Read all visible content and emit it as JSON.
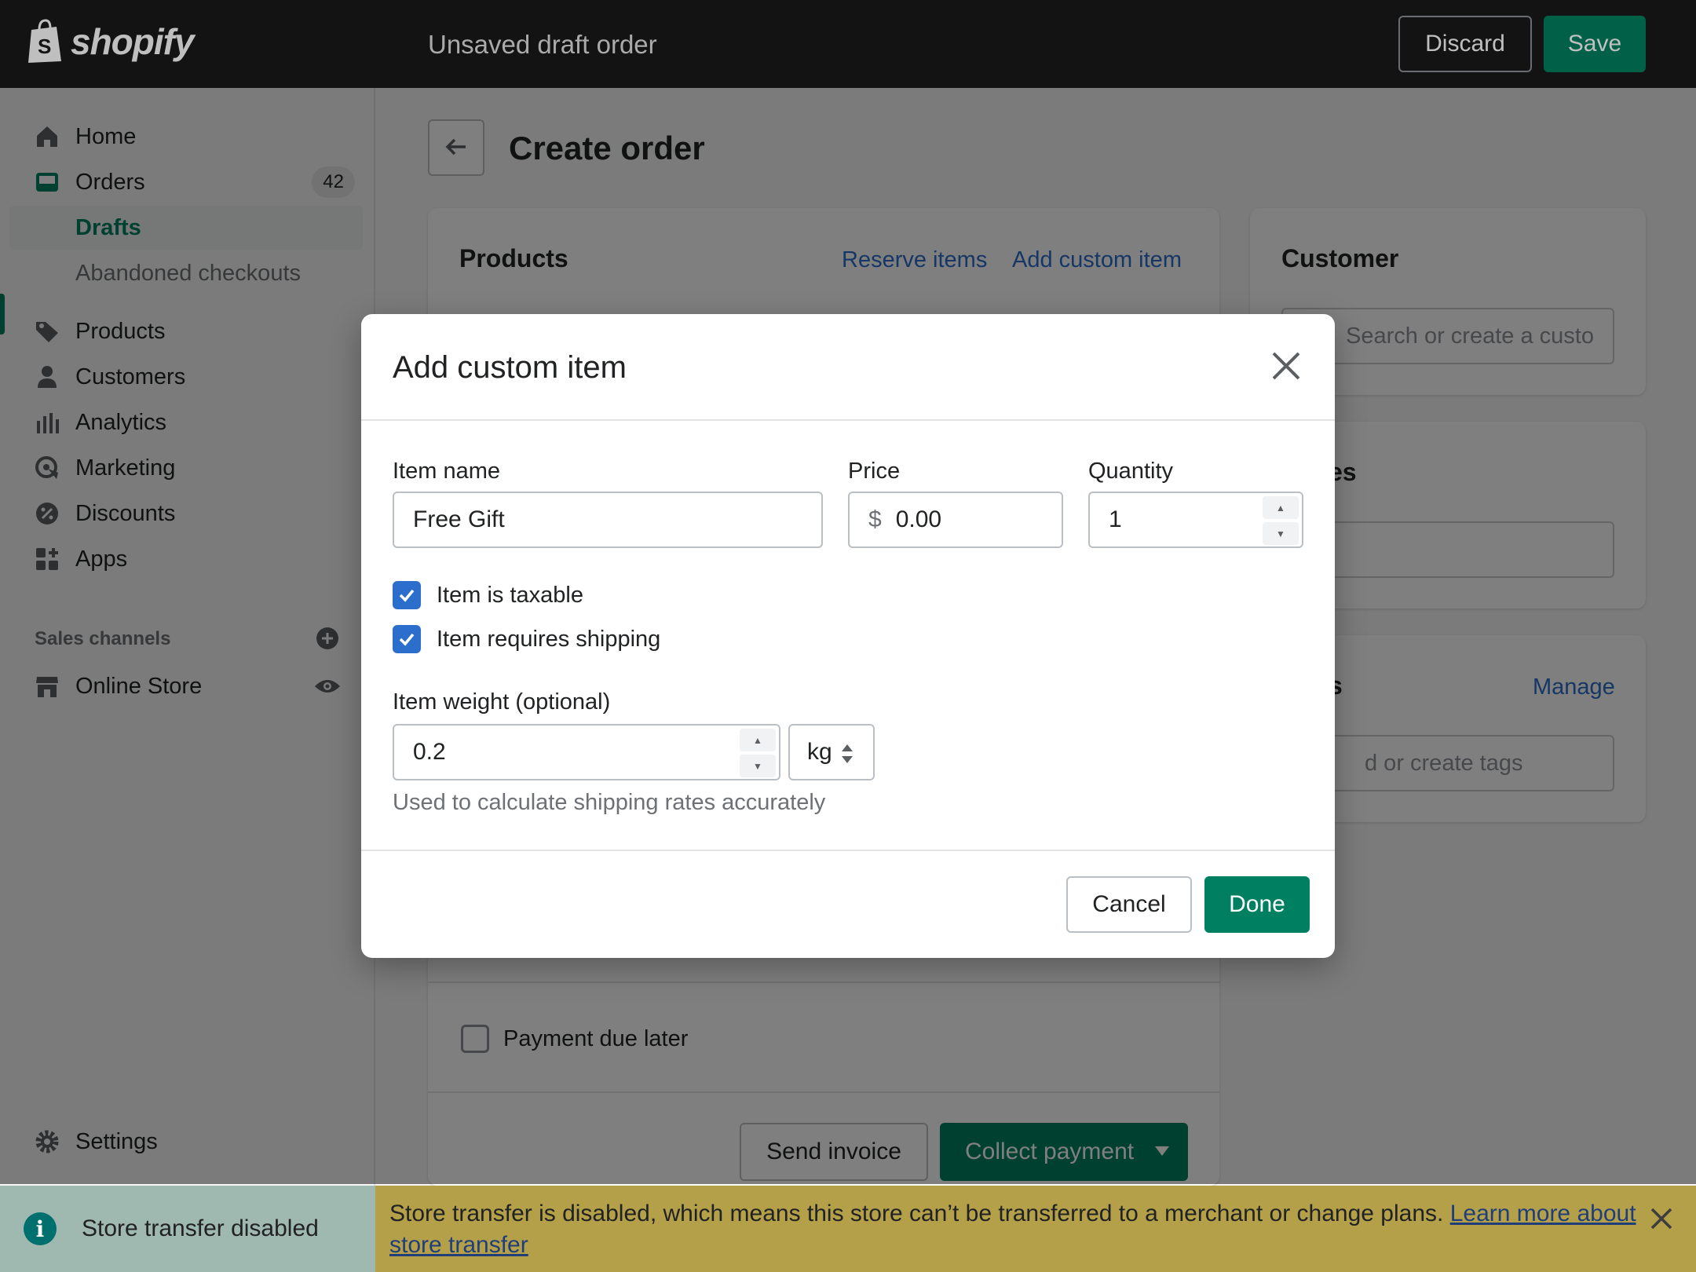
{
  "topbar": {
    "logo_text": "shopify",
    "title": "Unsaved draft order",
    "discard_label": "Discard",
    "save_label": "Save"
  },
  "sidebar": {
    "items": [
      {
        "label": "Home",
        "icon": "home-icon"
      },
      {
        "label": "Orders",
        "icon": "orders-icon",
        "badge": "42"
      },
      {
        "label": "Drafts"
      },
      {
        "label": "Abandoned checkouts"
      },
      {
        "label": "Products",
        "icon": "tag-icon"
      },
      {
        "label": "Customers",
        "icon": "person-icon"
      },
      {
        "label": "Analytics",
        "icon": "bar-chart-icon"
      },
      {
        "label": "Marketing",
        "icon": "target-icon"
      },
      {
        "label": "Discounts",
        "icon": "discount-icon"
      },
      {
        "label": "Apps",
        "icon": "apps-icon"
      }
    ],
    "sales_channels_label": "Sales channels",
    "online_store_label": "Online Store",
    "settings_label": "Settings"
  },
  "main": {
    "page_title": "Create order",
    "products": {
      "title": "Products",
      "reserve_label": "Reserve items",
      "add_custom_label": "Add custom item"
    },
    "customer": {
      "title": "Customer",
      "search_placeholder": "Search or create a custo"
    },
    "notes_title_partial": "es",
    "tags": {
      "title_partial": "s",
      "manage_label": "Manage",
      "placeholder_partial": "d or create tags"
    },
    "payment_due_later_label": "Payment due later",
    "send_invoice_label": "Send invoice",
    "collect_payment_label": "Collect payment"
  },
  "modal": {
    "title": "Add custom item",
    "item_name_label": "Item name",
    "item_name_value": "Free Gift",
    "price_label": "Price",
    "price_prefix": "$",
    "price_value": "0.00",
    "quantity_label": "Quantity",
    "quantity_value": "1",
    "taxable_label": "Item is taxable",
    "taxable_checked": true,
    "shipping_label": "Item requires shipping",
    "shipping_checked": true,
    "weight_label": "Item weight (optional)",
    "weight_value": "0.2",
    "weight_unit": "kg",
    "weight_help": "Used to calculate shipping rates accurately",
    "cancel_label": "Cancel",
    "done_label": "Done"
  },
  "banner": {
    "left_text": "Store transfer disabled",
    "right_text": "Store transfer is disabled, which means this store can’t be transferred to a merchant or change plans.",
    "link_text": "Learn more about store transfer"
  },
  "colors": {
    "accent": "#008060",
    "link": "#2c6ecb",
    "topbar": "#1a1a1a",
    "banner_warning": "#b5a04a"
  }
}
